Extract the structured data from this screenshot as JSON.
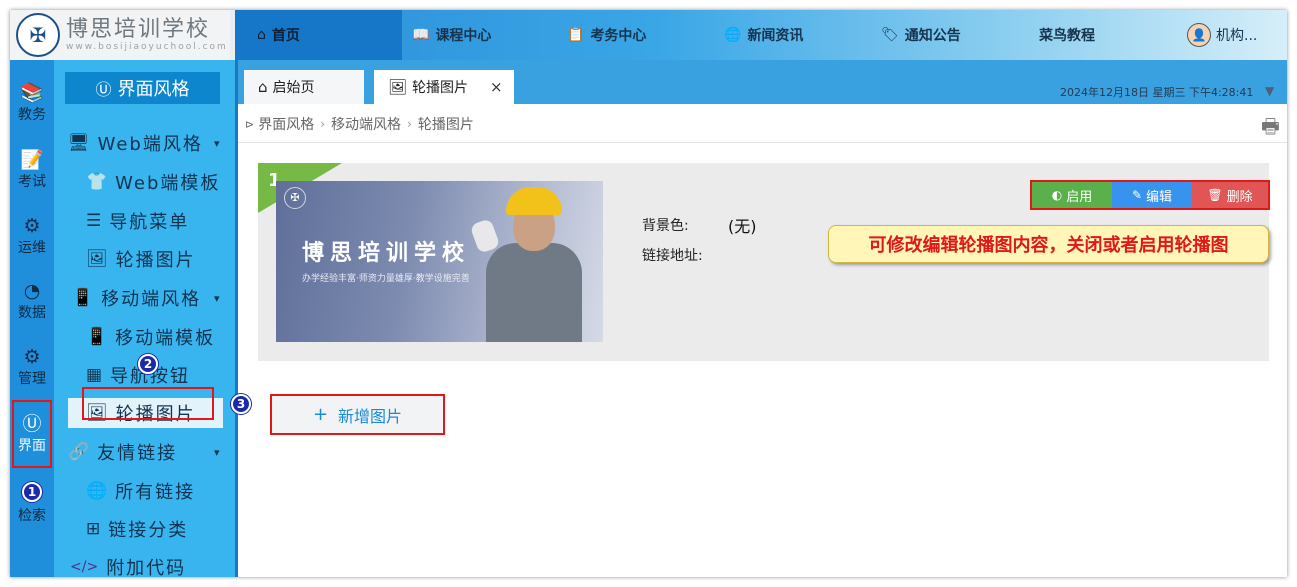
{
  "header": {
    "logo_glyph": "✠",
    "logo_title": "博思培训学校",
    "logo_subtitle": "www.bosijiaoyuchool.com",
    "nav": [
      {
        "icon": "⌂",
        "icon_name": "home-icon",
        "label": "首页",
        "active": true
      },
      {
        "icon": "📖",
        "icon_name": "book-icon",
        "label": "课程中心"
      },
      {
        "icon": "📋",
        "icon_name": "clipboard-icon",
        "label": "考务中心"
      },
      {
        "icon": "🌐",
        "icon_name": "globe-icon",
        "label": "新闻资讯"
      },
      {
        "icon": "🏷",
        "icon_name": "tag-icon",
        "label": "通知公告"
      },
      {
        "icon": "",
        "icon_name": "",
        "label": "菜鸟教程"
      },
      {
        "icon": "👤",
        "icon_name": "user-avatar-icon",
        "label": "机构..."
      }
    ]
  },
  "iconbar": {
    "items": [
      {
        "icon": "📚",
        "icon_name": "books-icon",
        "label": "教务"
      },
      {
        "icon": "📝",
        "icon_name": "exam-icon",
        "label": "考试"
      },
      {
        "icon": "⚙",
        "icon_name": "ops-icon",
        "label": "运维"
      },
      {
        "icon": "◔",
        "icon_name": "pie-chart-icon",
        "label": "数据"
      },
      {
        "icon": "⚙",
        "icon_name": "gear-icon",
        "label": "管理"
      },
      {
        "icon": "Ⓤ",
        "icon_name": "ui-icon",
        "label": "界面",
        "active": true
      },
      {
        "icon": "",
        "icon_name": "",
        "label": "检索"
      }
    ]
  },
  "menu": {
    "head_icon": "Ⓤ",
    "head_label": "界面风格",
    "items": [
      {
        "icon": "🖥",
        "icon_name": "monitor-icon",
        "label": "Web端风格",
        "arrow": "▾",
        "level": 0
      },
      {
        "icon": "👕",
        "icon_name": "shirt-icon",
        "label": "Web端模板",
        "level": 1
      },
      {
        "icon": "☰",
        "icon_name": "nav-menu-icon",
        "label": "导航菜单",
        "level": 1
      },
      {
        "icon": "🖼",
        "icon_name": "image-icon",
        "label": "轮播图片",
        "level": 1
      },
      {
        "icon": "📱",
        "icon_name": "phone-icon",
        "label": "移动端风格",
        "arrow": "▾",
        "level": 0
      },
      {
        "icon": "📱",
        "icon_name": "phone-icon",
        "label": "移动端模板",
        "level": 1
      },
      {
        "icon": "▦",
        "icon_name": "grid-icon",
        "label": "导航按钮",
        "level": 1
      },
      {
        "icon": "🖼",
        "icon_name": "image-icon",
        "label": "轮播图片",
        "level": 1,
        "active": true
      },
      {
        "icon": "🔗",
        "icon_name": "link-icon",
        "label": "友情链接",
        "arrow": "▾",
        "level": 0
      },
      {
        "icon": "🌐",
        "icon_name": "globe-icon",
        "label": "所有链接",
        "level": 1
      },
      {
        "icon": "⊞",
        "icon_name": "category-icon",
        "label": "链接分类",
        "level": 1
      },
      {
        "icon": "</>",
        "icon_name": "code-icon",
        "label": "附加代码",
        "level": 0
      }
    ]
  },
  "tabs": {
    "items": [
      {
        "icon": "⌂",
        "label": "启始页"
      },
      {
        "icon": "🖼",
        "label": "轮播图片",
        "close": "×",
        "active": true
      }
    ],
    "datetime": "2024年12月18日 星期三 下午4:28:41",
    "caret": "▼"
  },
  "breadcrumb": {
    "marker": "⊳",
    "items": [
      "界面风格",
      "移动端风格",
      "轮播图片"
    ],
    "separator": "›",
    "print_icon": "🖶"
  },
  "slide": {
    "index": "1",
    "banner_title": "博思培训学校",
    "banner_subtitle": "办学经验丰富·师资力量雄厚·教学设施完善",
    "bg_label": "背景色:",
    "bg_value": "(无)",
    "link_label": "链接地址:",
    "link_value": ""
  },
  "actions": {
    "enable": {
      "icon": "◐",
      "label": "启用",
      "color": "#5ab04a"
    },
    "edit": {
      "icon": "✎",
      "label": "编辑",
      "color": "#3794ee"
    },
    "delete": {
      "icon": "🗑",
      "label": "删除",
      "color": "#e05555"
    }
  },
  "callout": "可修改编辑轮播图内容，关闭或者启用轮播图",
  "add_button": {
    "icon": "+",
    "label": "新增图片"
  },
  "badges": [
    "1",
    "2",
    "3"
  ],
  "colors": {
    "accent": "#1f8fdc",
    "danger": "#e01818"
  }
}
